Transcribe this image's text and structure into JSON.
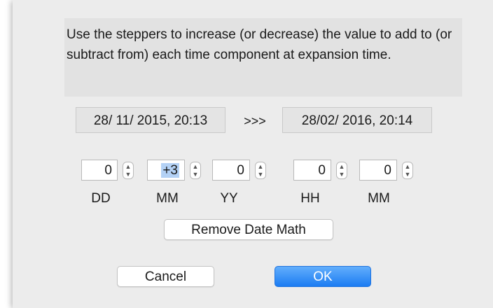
{
  "dialog": {
    "instructions": "Use the steppers to increase (or decrease) the value to add to (or subtract from) each time component at expansion time.",
    "original_date": "28/ 11/ 2015, 20:13",
    "separator": ">>>",
    "result_date": "28/02/ 2016, 20:14"
  },
  "steppers": [
    {
      "label": "DD",
      "value": "0",
      "icon": "up-down-stepper-icon"
    },
    {
      "label": "MM",
      "value": "+3",
      "icon": "up-down-stepper-icon",
      "selected": true
    },
    {
      "label": "YY",
      "value": "0",
      "icon": "up-down-stepper-icon"
    },
    {
      "label": "HH",
      "value": "0",
      "icon": "up-down-stepper-icon"
    },
    {
      "label": "MM",
      "value": "0",
      "icon": "up-down-stepper-icon"
    }
  ],
  "buttons": {
    "remove": "Remove Date Math",
    "cancel": "Cancel",
    "ok": "OK"
  },
  "colors": {
    "accent": "#1b7cf2",
    "selection": "#b3d1f5",
    "background": "#ececec"
  }
}
